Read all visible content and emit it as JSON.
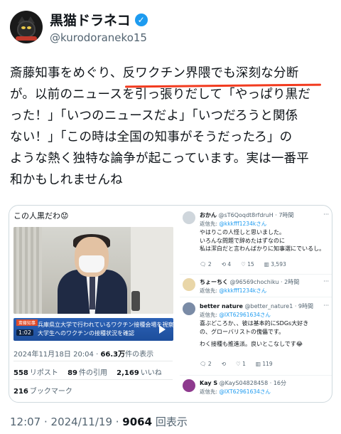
{
  "author": {
    "display_name": "黒猫ドラネコ",
    "handle": "@kurodoraneko15",
    "verified_icon": "✓"
  },
  "post": {
    "lines": [
      "斎藤知事をめぐり、反ワクチン界隈でも深刻な分断",
      "が。以前のニュースを引っ張りだして「やっぱり黒だ",
      "った！」「いつのニュースだよ」「いつだろうと関係",
      "ない！」「この時は全国の知事がそうだったろ」の",
      "ような熱く独特な論争が起こっています。実は一番平",
      "和かもしれませんね"
    ],
    "highlight_color": "#f23b1f"
  },
  "embed": {
    "caption": "この人黒だわ😟",
    "video": {
      "badge": "斎藤知事",
      "headline_1": "兵庫県立大学で行われているワクチン接種会場を視察",
      "headline_2": "大学生へのワクチンの接種状況を確認",
      "duration": "1:02"
    },
    "meta": {
      "time": "2024年11月18日 20:04",
      "views_value": "66.3万",
      "views_label": "件の表示"
    },
    "stats": {
      "reposts_value": "558",
      "reposts_label": "リポスト",
      "quotes_value": "89",
      "quotes_label": "件の引用",
      "likes_value": "2,169",
      "likes_label": "いいね",
      "bookmarks_value": "216",
      "bookmarks_label": "ブックマーク"
    },
    "replies": [
      {
        "name": "おかん",
        "meta": "@sT6Qoqdt8rfdruH · 7時間",
        "to_label": "返信先: ",
        "to_handle": "@kkkfff1234kさん",
        "body": [
          "やはりこの人怪しと思いました。",
          "いろんな問題で辞めたはずなのに",
          "私は潔白だと言わんばかりに知事選にでいるし。"
        ],
        "actions": [
          "2",
          "4",
          "15",
          "3,593"
        ],
        "avatar_color": "#cfd6dc"
      },
      {
        "name": "ちょーちく",
        "meta": "@96569chochiku · 2時間",
        "to_label": "返信先: ",
        "to_handle": "@kkkfff1234kさん",
        "body": [],
        "actions": [],
        "avatar_color": "#e9d6a8"
      },
      {
        "name": "better nature",
        "meta": "@better_nature1 · 9時間",
        "to_label": "返信先: ",
        "to_handle": "@IXT62961634さん",
        "body": [
          "喜ぶどころか、、彼は基本的にSDGs大好き",
          "の、グローバリストの傀儡です。",
          "",
          "わく接種も推進派。良いとこなしです😂"
        ],
        "actions": [
          "2",
          "1",
          "119"
        ],
        "avatar_color": "#7a8ba6"
      },
      {
        "name": "Kay S",
        "meta": "@KayS04828458 · 16分",
        "to_label": "返信先: ",
        "to_handle": "@IXT62961634さん",
        "body": [],
        "actions": [],
        "avatar_color": "#8e3a8e"
      }
    ]
  },
  "footer": {
    "time": "12:07 · 2024/11/19 · ",
    "views_value": "9064",
    "views_label": "回表示"
  }
}
